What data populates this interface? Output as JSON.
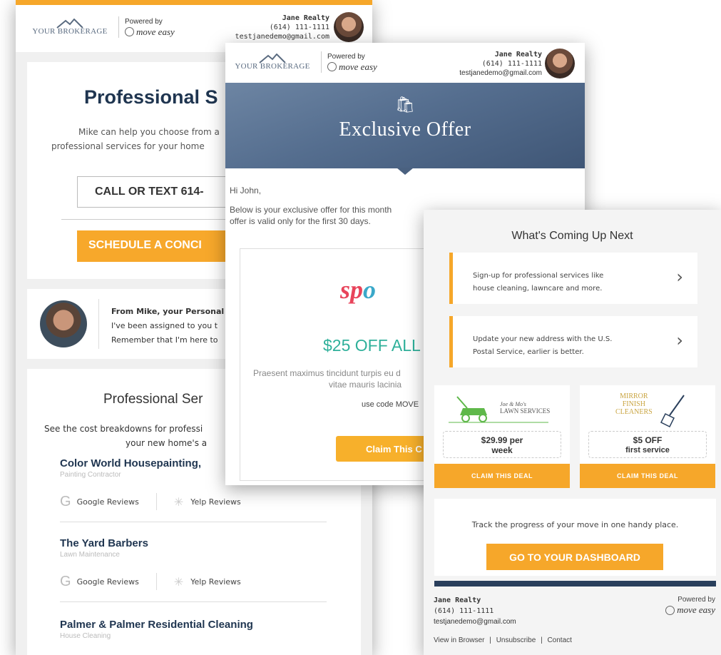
{
  "common": {
    "brokerage_logo": "YOUR BROKERAGE",
    "powered_by": "Powered by",
    "move_easy": "move easy"
  },
  "card1": {
    "agent_name": "Jane Realty",
    "agent_phone": "(614) 111-1111",
    "agent_email": "testjanedemo@gmail.com",
    "heading": "Professional S",
    "intro_lines": [
      "Mike can help you choose from a",
      "professional services for your home"
    ],
    "call_button": "CALL OR TEXT 614-",
    "schedule_button": "SCHEDULE A CONCI",
    "mike_heading": "From Mike, your Personal",
    "mike_line1": "I've been assigned to you t",
    "mike_line2": "Remember that I'm here to",
    "services_heading": "Professional Ser",
    "services_desc": [
      "See the cost breakdowns for professi",
      "your new home's a"
    ],
    "businesses": [
      {
        "name": "Color World Housepainting,",
        "category": "Painting Contractor",
        "google": "Google Reviews",
        "yelp": "Yelp Reviews"
      },
      {
        "name": "The Yard Barbers",
        "category": "Lawn Maintenance",
        "google": "Google Reviews",
        "yelp": "Yelp Reviews"
      },
      {
        "name": "Palmer & Palmer Residential Cleaning",
        "category": "House Cleaning"
      }
    ]
  },
  "card2": {
    "agent_name": "Jane Realty",
    "agent_phone": "(614) 111-1111",
    "agent_email": "testjanedemo@gmail.com",
    "hero_title": "Exclusive Offer",
    "greeting": "Hi John,",
    "body_line1": "Below is your exclusive offer for this month",
    "body_line2": "offer is valid only for the first 30 days.",
    "brand_a": "sp",
    "brand_b": "o",
    "offer_amount": "$25 OFF ALL",
    "lorem_line1": "Praesent maximus tincidunt turpis eu d",
    "lorem_line2": "vitae mauris lacinia",
    "code_text": "use code MOVE",
    "claim_button": "Claim This C"
  },
  "card3": {
    "title": "What's Coming Up Next",
    "steps": [
      {
        "line1": "Sign-up for professional services like",
        "line2": "house cleaning, lawncare and more."
      },
      {
        "line1": "Update your new address with the U.S.",
        "line2": "Postal Service, earlier is better."
      }
    ],
    "deals": [
      {
        "logo_line1": "Joe & Mo's",
        "logo_line2": "LAWN SERVICES",
        "price_line1": "$29.99 per",
        "price_line2": "week",
        "cta": "CLAIM THIS DEAL"
      },
      {
        "logo_line1": "MIRROR",
        "logo_line2": "FINISH",
        "logo_line3": "CLEANERS",
        "price_line1": "$5 OFF",
        "price_line2": "first service",
        "cta": "CLAIM THIS DEAL"
      }
    ],
    "track_text": "Track the progress of your move in one handy place.",
    "dashboard_button": "GO TO YOUR DASHBOARD",
    "footer_name": "Jane Realty",
    "footer_phone": "(614) 111-1111",
    "footer_email": "testjanedemo@gmail.com",
    "links": [
      "View in Browser",
      "|",
      "Unsubscribe",
      "|",
      "Contact"
    ]
  },
  "colors": {
    "accent": "#f6a72a",
    "navy": "#1f3550",
    "teal": "#2fb09a",
    "hero": "#556e8f"
  }
}
